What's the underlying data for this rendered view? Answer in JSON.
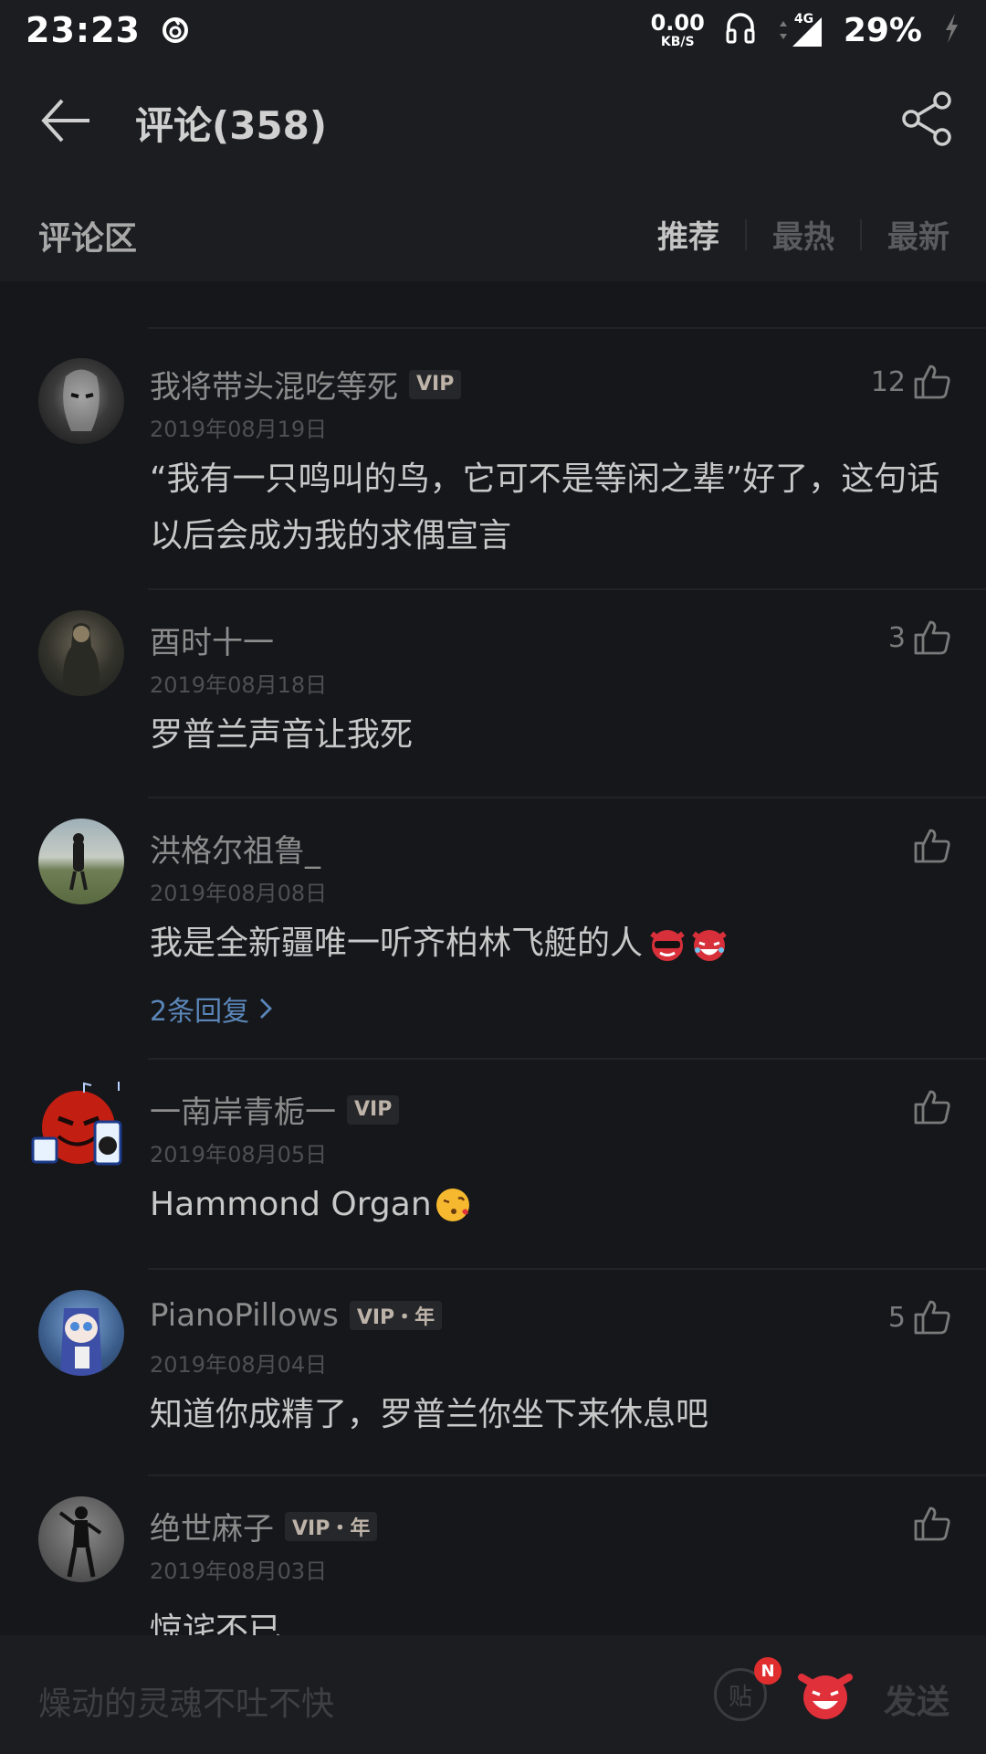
{
  "status_bar": {
    "time": "23:23",
    "net_speed_value": "0.00",
    "net_speed_unit": "KB/S",
    "network": "4G",
    "battery": "29%"
  },
  "header": {
    "title": "评论(358)"
  },
  "section": {
    "title": "评论区",
    "tabs": [
      "推荐",
      "最热",
      "最新"
    ]
  },
  "comments": [
    {
      "name": "我将带头混吃等死",
      "vip": "VIP",
      "date": "2019年08月19日",
      "likes": "12",
      "text": "“我有一只鸣叫的鸟，它可不是等闲之辈”好了，这句话以后会成为我的求偶宣言"
    },
    {
      "name": "酉时十一",
      "vip": "",
      "date": "2019年08月18日",
      "likes": "3",
      "text": "罗普兰声音让我死"
    },
    {
      "name": "洪格尔祖鲁_",
      "vip": "",
      "date": "2019年08月08日",
      "likes": "",
      "text": "我是全新疆唯一听齐柏林飞艇的人",
      "reply": "2条回复"
    },
    {
      "name": "一南岸青栀一",
      "vip": "VIP",
      "date": "2019年08月05日",
      "likes": "",
      "text": "Hammond Organ"
    },
    {
      "name": "PianoPillows",
      "vip": "VIP・年",
      "date": "2019年08月04日",
      "likes": "5",
      "text": "知道你成精了，罗普兰你坐下来休息吧"
    },
    {
      "name": "绝世麻子",
      "vip": "VIP・年",
      "date": "2019年08月03日",
      "likes": "",
      "text": "惊诧不已"
    }
  ],
  "bottom_bar": {
    "placeholder": "燥动的灵魂不吐不快",
    "post_label": "贴",
    "badge": "N",
    "send": "发送"
  },
  "colors": {
    "background": "#16171b",
    "bar": "#1c1d21",
    "link": "#5a86b8",
    "badge": "#e02e2e"
  }
}
